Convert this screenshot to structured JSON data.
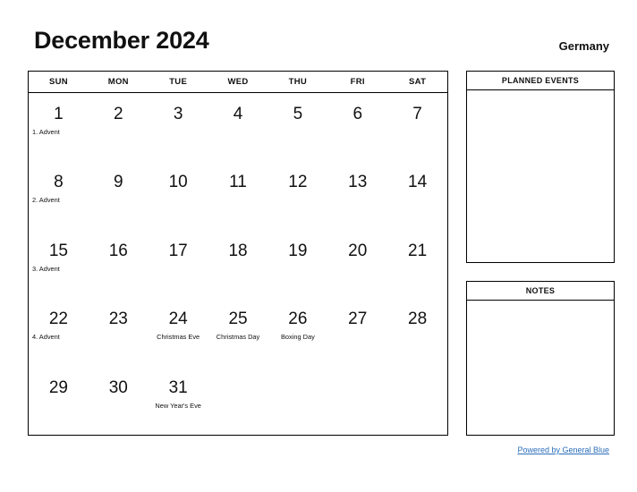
{
  "header": {
    "title": "December 2024",
    "country": "Germany"
  },
  "calendar": {
    "weekdays": [
      "SUN",
      "MON",
      "TUE",
      "WED",
      "THU",
      "FRI",
      "SAT"
    ],
    "weeks": [
      [
        {
          "day": "1",
          "event": "1. Advent",
          "align": "left"
        },
        {
          "day": "2",
          "event": "",
          "align": "center"
        },
        {
          "day": "3",
          "event": "",
          "align": "center"
        },
        {
          "day": "4",
          "event": "",
          "align": "center"
        },
        {
          "day": "5",
          "event": "",
          "align": "center"
        },
        {
          "day": "6",
          "event": "",
          "align": "center"
        },
        {
          "day": "7",
          "event": "",
          "align": "center"
        }
      ],
      [
        {
          "day": "8",
          "event": "2. Advent",
          "align": "left"
        },
        {
          "day": "9",
          "event": "",
          "align": "center"
        },
        {
          "day": "10",
          "event": "",
          "align": "center"
        },
        {
          "day": "11",
          "event": "",
          "align": "center"
        },
        {
          "day": "12",
          "event": "",
          "align": "center"
        },
        {
          "day": "13",
          "event": "",
          "align": "center"
        },
        {
          "day": "14",
          "event": "",
          "align": "center"
        }
      ],
      [
        {
          "day": "15",
          "event": "3. Advent",
          "align": "left"
        },
        {
          "day": "16",
          "event": "",
          "align": "center"
        },
        {
          "day": "17",
          "event": "",
          "align": "center"
        },
        {
          "day": "18",
          "event": "",
          "align": "center"
        },
        {
          "day": "19",
          "event": "",
          "align": "center"
        },
        {
          "day": "20",
          "event": "",
          "align": "center"
        },
        {
          "day": "21",
          "event": "",
          "align": "center"
        }
      ],
      [
        {
          "day": "22",
          "event": "4. Advent",
          "align": "left"
        },
        {
          "day": "23",
          "event": "",
          "align": "center"
        },
        {
          "day": "24",
          "event": "Christmas Eve",
          "align": "center"
        },
        {
          "day": "25",
          "event": "Christmas Day",
          "align": "center"
        },
        {
          "day": "26",
          "event": "Boxing Day",
          "align": "center"
        },
        {
          "day": "27",
          "event": "",
          "align": "center"
        },
        {
          "day": "28",
          "event": "",
          "align": "center"
        }
      ],
      [
        {
          "day": "29",
          "event": "",
          "align": "center"
        },
        {
          "day": "30",
          "event": "",
          "align": "center"
        },
        {
          "day": "31",
          "event": "New Year's Eve",
          "align": "center"
        },
        {
          "day": "",
          "event": "",
          "align": "center"
        },
        {
          "day": "",
          "event": "",
          "align": "center"
        },
        {
          "day": "",
          "event": "",
          "align": "center"
        },
        {
          "day": "",
          "event": "",
          "align": "center"
        }
      ]
    ]
  },
  "panels": {
    "planned_events": {
      "title": "PLANNED EVENTS",
      "content": ""
    },
    "notes": {
      "title": "NOTES",
      "content": ""
    }
  },
  "footer": {
    "link_text": "Powered by General Blue",
    "link_color": "#2a6ebb"
  }
}
